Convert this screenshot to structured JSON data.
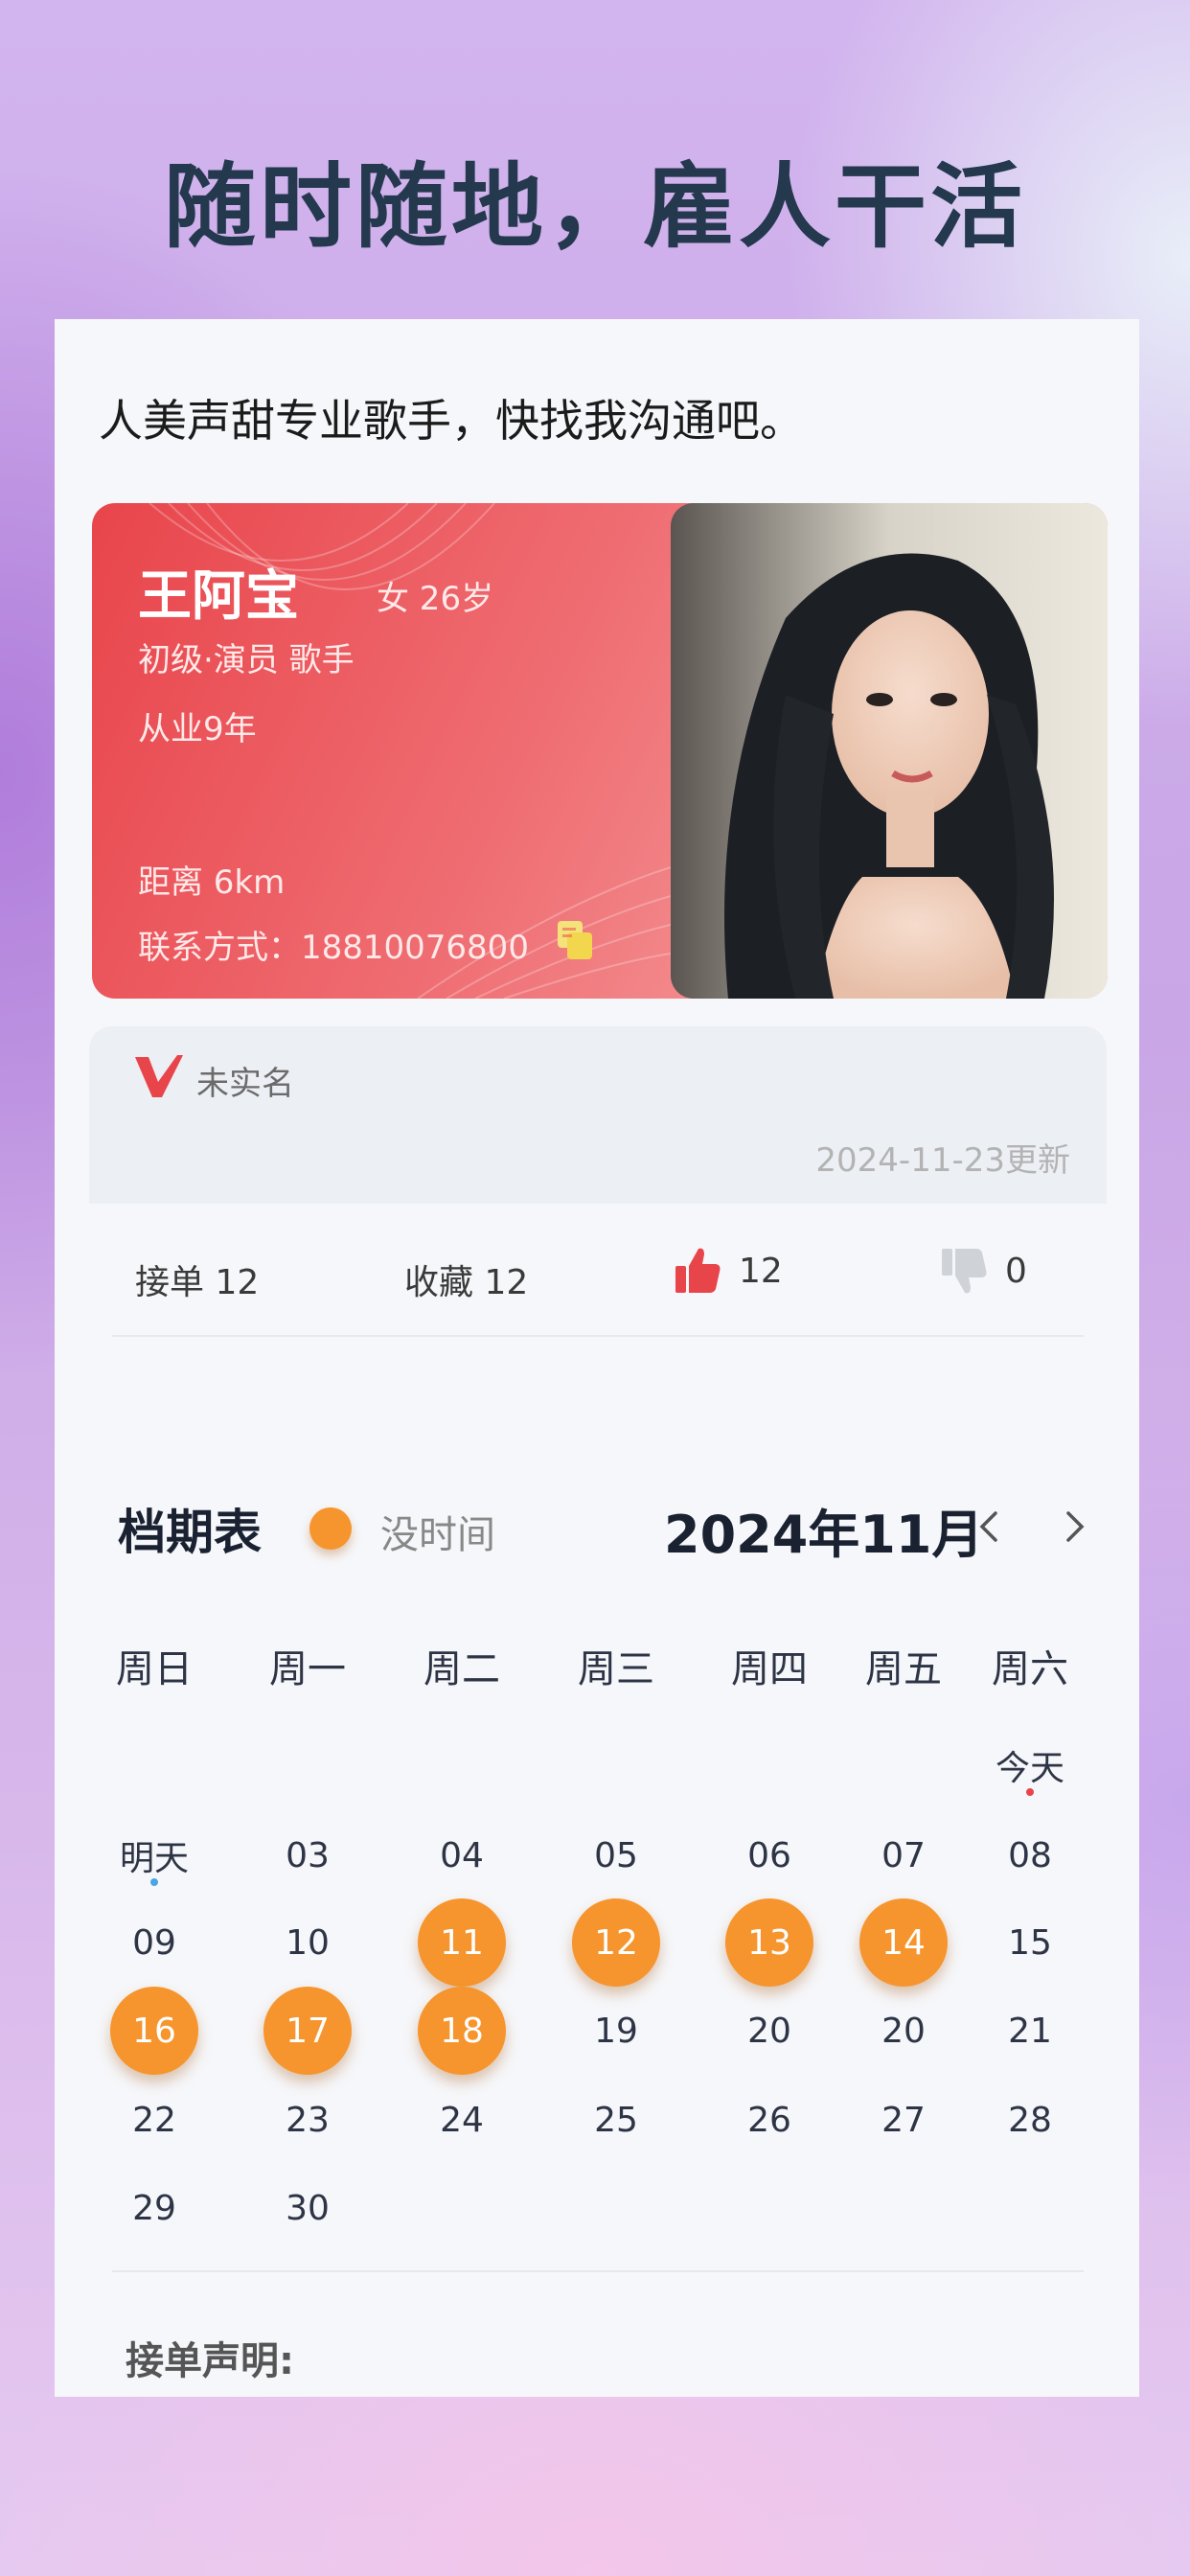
{
  "headline": "随时随地，雇人干活",
  "bio": "人美声甜专业歌手，快找我沟通吧。",
  "profile": {
    "name": "王阿宝",
    "gender_age": "女 26岁",
    "level": "初级·演员  歌手",
    "years": "从业9年",
    "distance": "距离 6km",
    "contact": "联系方式：18810076800",
    "copy_icon": "copy-icon",
    "accent_color": "#e8454b"
  },
  "verify": {
    "status": "未实名",
    "updated": "2024-11-23更新"
  },
  "stats": {
    "orders": "接单 12",
    "favorites": "收藏 12",
    "likes": "12",
    "dislikes": "0"
  },
  "schedule": {
    "title": "档期表",
    "busy_label": "没时间",
    "month": "2024年11月",
    "busy_color": "#f6952d",
    "weekdays": [
      "周日",
      "周一",
      "周二",
      "周三",
      "周四",
      "周五",
      "周六"
    ],
    "today_label": "今天",
    "tomorrow_label": "明天",
    "days": [
      "03",
      "04",
      "05",
      "06",
      "07",
      "08",
      "09",
      "10",
      "11",
      "12",
      "13",
      "14",
      "15",
      "16",
      "17",
      "18",
      "19",
      "20",
      "20",
      "21",
      "22",
      "23",
      "24",
      "25",
      "26",
      "27",
      "28",
      "29",
      "30"
    ],
    "busy_days": [
      "11",
      "12",
      "13",
      "14",
      "16",
      "17",
      "18"
    ]
  },
  "statement_label": "接单声明:"
}
